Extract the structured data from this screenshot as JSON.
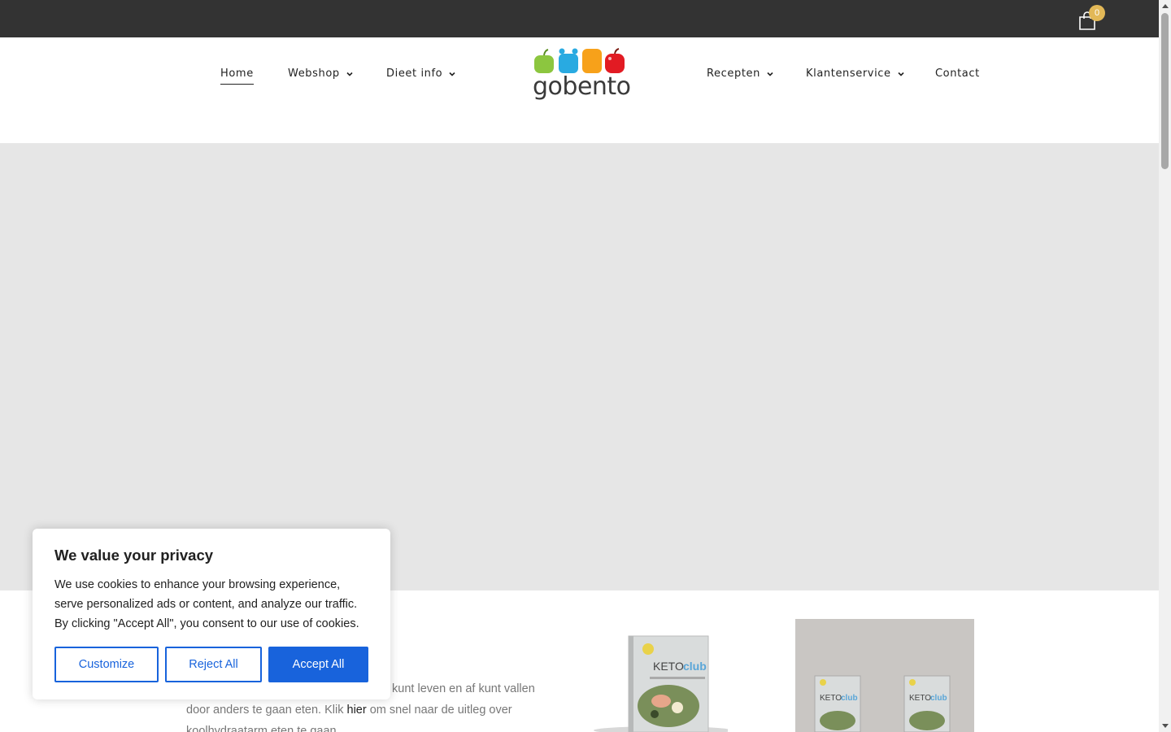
{
  "topbar": {
    "cart_count": "0",
    "cart_icon": "shopping-bag-icon"
  },
  "nav": {
    "left": [
      {
        "label": "Home",
        "active": true
      },
      {
        "label": "Webshop",
        "dropdown": true
      },
      {
        "label": "Dieet info",
        "dropdown": true
      }
    ],
    "right": [
      {
        "label": "Recepten",
        "dropdown": true
      },
      {
        "label": "Klantenservice",
        "dropdown": true
      },
      {
        "label": "Contact"
      }
    ]
  },
  "logo": {
    "text": "gobento",
    "fruit_colors": [
      "#8cc63f",
      "#29aae1",
      "#f7a11a",
      "#e21b23"
    ]
  },
  "intro": {
    "line1": "nder kunt leven en af kunt vallen",
    "line2_pre": "door anders te gaan eten. Klik ",
    "link": "hier",
    "line2_post": " om snel naar de uitleg over",
    "line3": "koolhydraatarm eten te gaan."
  },
  "products": {
    "book_title": "KETOclub"
  },
  "cookie": {
    "title": "We value your privacy",
    "body": "We use cookies to enhance your browsing experience, serve personalized ads or content, and analyze our traffic. By clicking \"Accept All\", you consent to our use of cookies.",
    "customize": "Customize",
    "reject": "Reject All",
    "accept": "Accept All",
    "accent_color": "#1863dc"
  },
  "colors": {
    "topbar": "#333333",
    "badge": "#e2b857",
    "hero": "#e6e6e6"
  }
}
